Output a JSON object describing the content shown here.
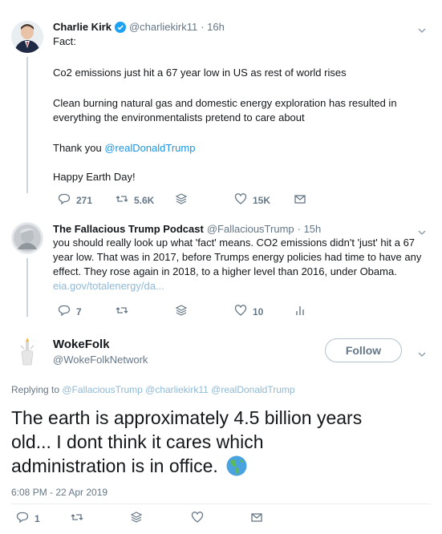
{
  "tweet1": {
    "author": "Charlie Kirk",
    "handle": "@charliekirk11",
    "time": "· 16h",
    "lines": [
      "Fact:",
      "Co2 emissions just hit a 67 year low in US as rest of world rises",
      "Clean burning natural gas and domestic energy exploration has resulted in",
      "everything the environmentalists pretend to care about"
    ],
    "thank_prefix": "Thank you ",
    "thank_mention": "@realDonaldTrump",
    "closing": "Happy Earth Day!",
    "replies": "271",
    "retweets": "5.6K",
    "likes": "15K"
  },
  "tweet2": {
    "author": "The Fallacious Trump Podcast",
    "handle": "@FallaciousTrump",
    "time": "· 15h",
    "lines": [
      "you should really look up what 'fact' means.  CO2 emissions didn't 'just' hit a 67",
      "year low.  That was in 2017, before Trumps energy policies had time to have any",
      "effect.  They rose again in 2018, to a higher level than 2016, under Obama."
    ],
    "link": "eia.gov/totalenergy/da...",
    "replies": "7",
    "likes": "10"
  },
  "tweet3": {
    "author": "WokeFolk",
    "handle": "@WokeFolkNetwork",
    "follow_label": "Follow",
    "replying_prefix": "Replying to",
    "replying_to": "@FallaciousTrump @charliekirk11 @realDonaldTrump",
    "big_lines": [
      "The earth is approximately 4.5 billion years",
      "old... I dont think it cares which",
      "administration is in office."
    ],
    "timestamp": "6:08 PM - 22 Apr 2019",
    "replies": "1"
  }
}
